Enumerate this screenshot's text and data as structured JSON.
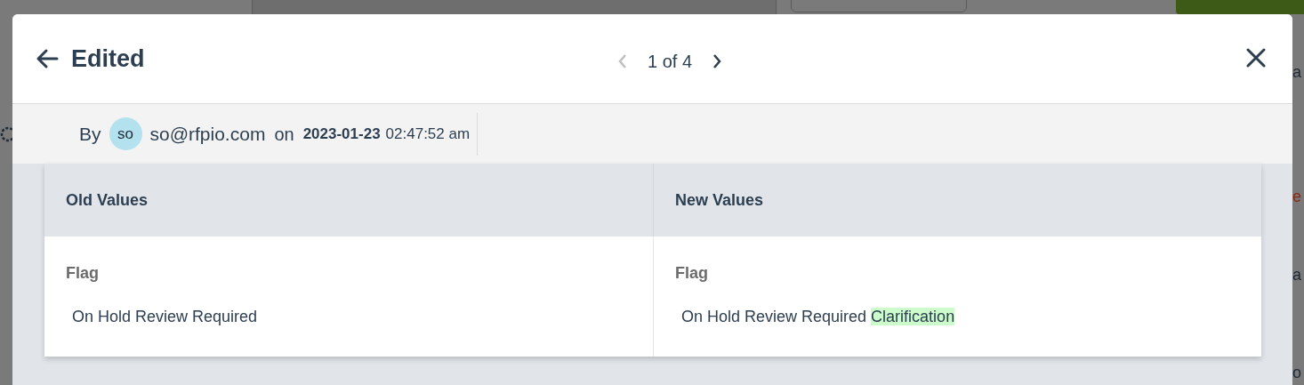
{
  "background": {
    "edge_texts": [
      {
        "text": "a",
        "kind": "dark"
      },
      {
        "text": "e",
        "kind": "accent"
      },
      {
        "text": "a",
        "kind": "dark"
      },
      {
        "text": "o",
        "kind": "dark"
      }
    ]
  },
  "modal": {
    "title": "Edited",
    "pager": {
      "text": "1 of 4",
      "prev_disabled": true,
      "next_disabled": false
    },
    "meta": {
      "by_label": "By",
      "avatar": "so",
      "user": "so@rfpio.com",
      "on_label": "on",
      "date": "2023-01-23",
      "time": "02:47:52 am"
    },
    "table": {
      "columns": [
        "Old Values",
        "New Values"
      ],
      "cells": [
        {
          "field": "Flag",
          "segments": [
            {
              "text": "On Hold Review Required",
              "added": false
            }
          ]
        },
        {
          "field": "Flag",
          "segments": [
            {
              "text": "On Hold Review Required ",
              "added": false
            },
            {
              "text": "Clarification",
              "added": true
            }
          ]
        }
      ]
    }
  }
}
